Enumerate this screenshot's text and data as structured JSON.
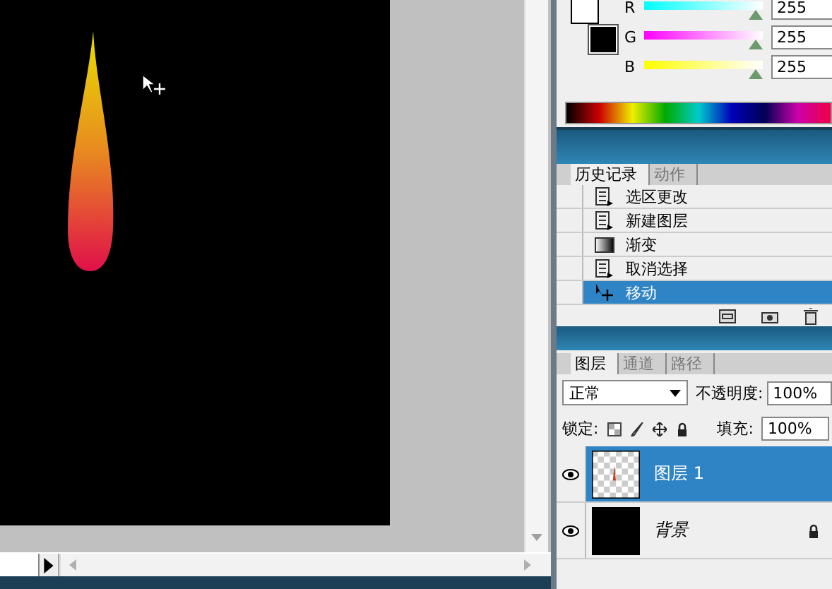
{
  "color_panel": {
    "channels": [
      {
        "label": "R",
        "value": "255",
        "level": 1
      },
      {
        "label": "G",
        "value": "255",
        "level": 1
      },
      {
        "label": "B",
        "value": "255",
        "level": 1
      }
    ]
  },
  "history_panel": {
    "tabs": [
      {
        "label": "历史记录",
        "selected": true
      },
      {
        "label": "动作",
        "selected": false
      }
    ],
    "items": [
      {
        "label": "选区更改",
        "kind": "document",
        "selected": false
      },
      {
        "label": "新建图层",
        "kind": "document",
        "selected": false
      },
      {
        "label": "渐变",
        "kind": "gradient",
        "selected": false
      },
      {
        "label": "取消选择",
        "kind": "document",
        "selected": false
      },
      {
        "label": "移动",
        "kind": "move",
        "selected": true
      }
    ]
  },
  "layers_panel": {
    "tabs": [
      {
        "label": "图层",
        "selected": true
      },
      {
        "label": "通道",
        "selected": false
      },
      {
        "label": "路径",
        "selected": false
      }
    ],
    "blend_mode": "正常",
    "opacity_label": "不透明度:",
    "opacity": "100%",
    "lock_label": "锁定:",
    "fill_label": "填充:",
    "fill": "100%",
    "layers": [
      {
        "name": "图层 1",
        "kind": "transparent",
        "visible": true,
        "selected": true,
        "locked": false
      },
      {
        "name": "背景",
        "kind": "black",
        "visible": true,
        "selected": false,
        "locked": true
      }
    ]
  }
}
